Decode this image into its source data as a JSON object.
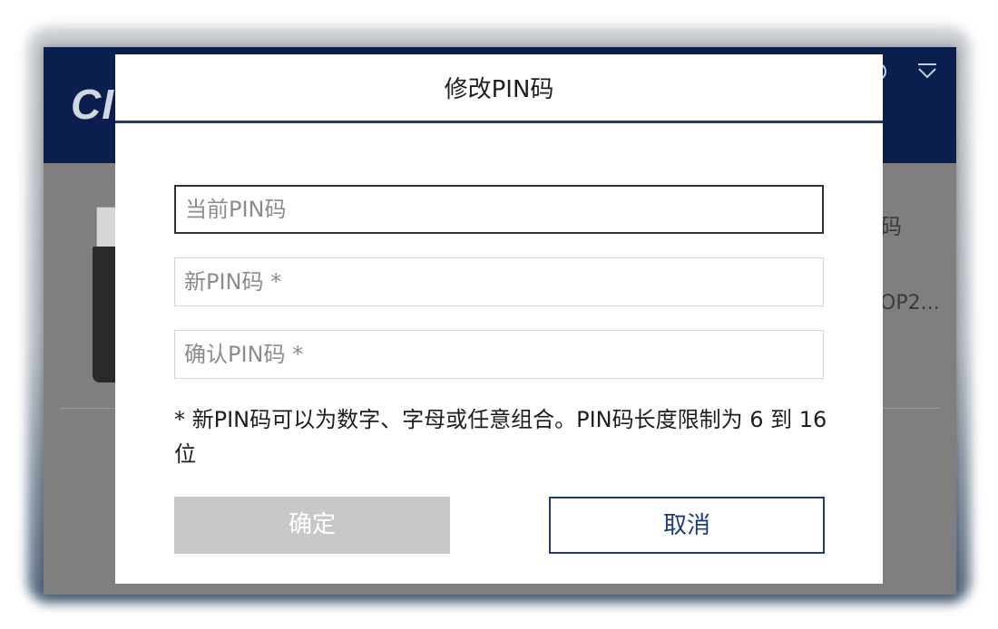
{
  "app": {
    "logo_text": "CI",
    "body_right_text_1": "码",
    "body_right_text_2": "OP2..."
  },
  "dialog": {
    "title": "修改PIN码",
    "fields": {
      "current_pin_placeholder": "当前PIN码",
      "new_pin_placeholder": "新PIN码 *",
      "confirm_pin_placeholder": "确认PIN码 *"
    },
    "hint": "* 新PIN码可以为数字、字母或任意组合。PIN码长度限制为 6 到 16 位",
    "buttons": {
      "ok_label": "确定",
      "cancel_label": "取消"
    }
  },
  "colors": {
    "header_bg": "#0a1f4d",
    "accent": "#1f3c78",
    "disabled_button": "#c8c8c8"
  },
  "icons": {
    "header_right_1": "circle-icon",
    "header_right_2": "dropdown-menu-icon"
  }
}
